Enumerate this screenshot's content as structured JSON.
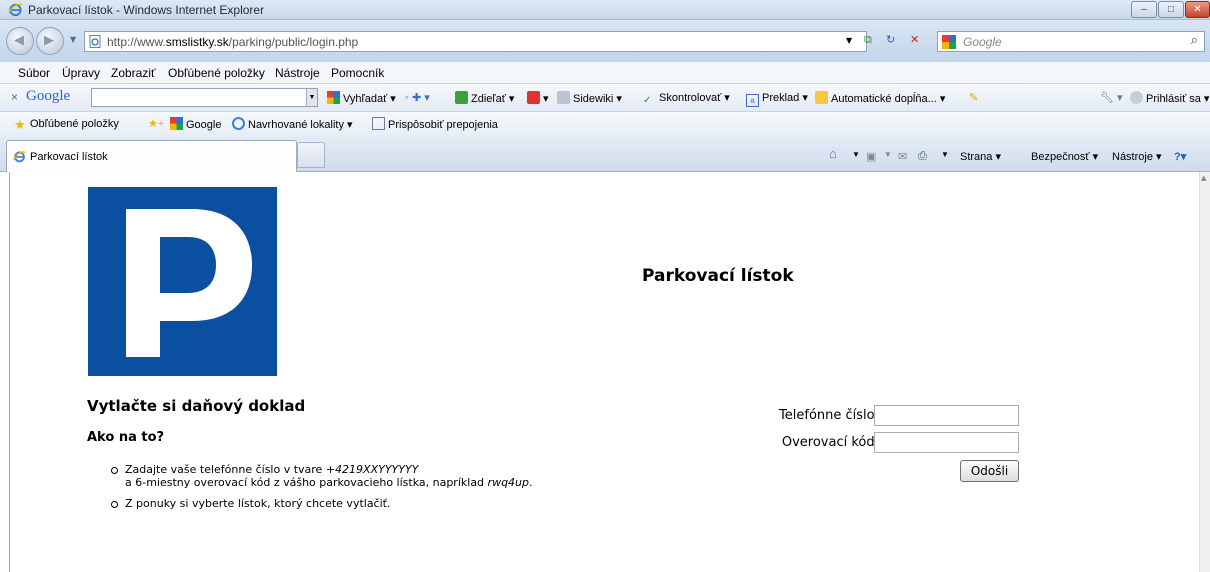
{
  "window": {
    "title": "Parkovací lístok - Windows Internet Explorer",
    "buttons": {
      "minimize": "–",
      "maximize": "□",
      "close": "✕"
    }
  },
  "address_bar": {
    "url_prefix": "http://www.",
    "url_domain": "smslistky.sk",
    "url_path": "/parking/public/login.php",
    "search_placeholder": "Google"
  },
  "menu": [
    "Súbor",
    "Úpravy",
    "Zobraziť",
    "Obľúbené položky",
    "Nástroje",
    "Pomocník"
  ],
  "google_toolbar": {
    "logo": "Google",
    "search_label": "Vyhľadať",
    "share_label": "Zdieľať",
    "sidewiki_label": "Sidewiki",
    "spellcheck_label": "Skontrolovať",
    "translate_label": "Preklad",
    "autofill_label": "Automatické dopĺňa...",
    "signin_label": "Prihlásiť sa"
  },
  "favorites_bar": {
    "favorites_label": "Obľúbené položky",
    "google_label": "Google",
    "suggested_label": "Navrhované lokality",
    "customize_label": "Prispôsobiť prepojenia"
  },
  "tab": {
    "label": "Parkovací lístok"
  },
  "command_bar": {
    "page_label": "Strana",
    "safety_label": "Bezpečnosť",
    "tools_label": "Nástroje"
  },
  "page": {
    "title": "Parkovací lístok",
    "heading_print": "Vytlačte si daňový doklad",
    "heading_how": "Ako na to?",
    "step1_line1": "Zadajte vaše telefónne číslo v tvare ",
    "step1_format": "+4219XXYYYYYY",
    "step1_line2": "a 6-miestny overovací kód z vášho parkovacieho lístka, napríklad ",
    "step1_example": "rwq4up",
    "step1_end": ".",
    "step2": "Z ponuky si vyberte lístok, ktorý chcete vytlačiť.",
    "phone_label": "Telefónne číslo:",
    "code_label": "Overovací kód:",
    "phone_value": "",
    "code_value": "",
    "submit_label": "Odošli"
  },
  "colors": {
    "parking_blue": "#0b4fa0"
  }
}
